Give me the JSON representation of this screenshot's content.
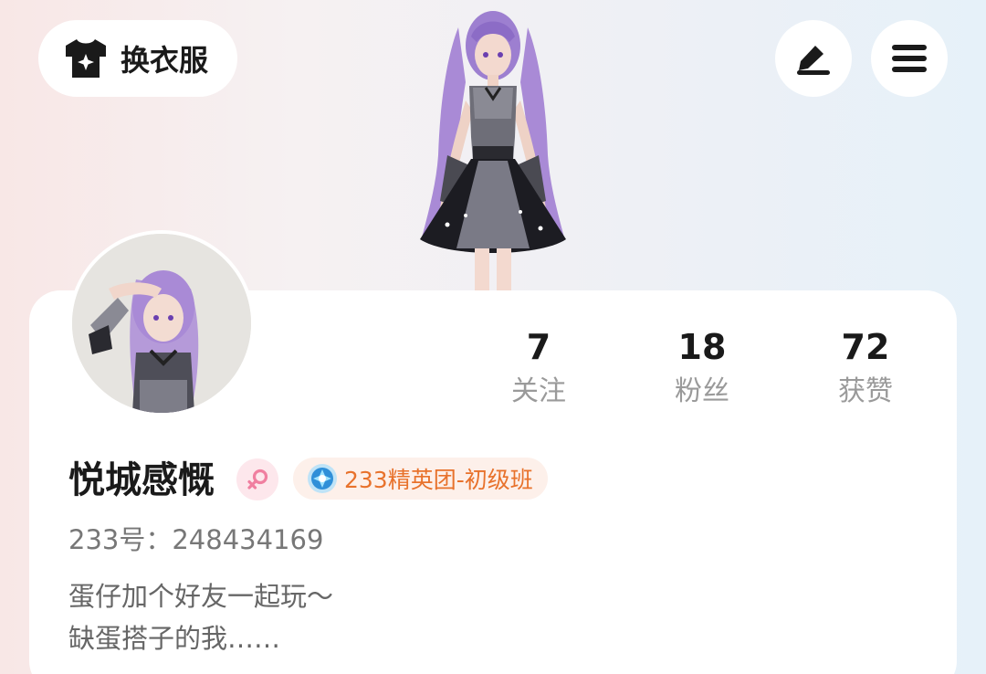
{
  "header": {
    "outfit_label": "换衣服",
    "outfit_icon": "tshirt-sparkle-icon",
    "edit_icon": "pen-icon",
    "menu_icon": "hamburger-menu-icon"
  },
  "profile": {
    "username": "悦城感慨",
    "gender_icon": "female-icon",
    "level_badge": "233精英团-初级班",
    "level_icon": "blue-gem-medal-icon",
    "user_id": "233号：248434169",
    "bio_lines": [
      "蛋仔加个好友一起玩～",
      "缺蛋搭子的我……"
    ]
  },
  "stats": [
    {
      "value": "7",
      "label": "关注"
    },
    {
      "value": "18",
      "label": "粉丝"
    },
    {
      "value": "72",
      "label": "获赞"
    }
  ],
  "colors": {
    "level_text": "#e8722c",
    "gender_pink": "#f07fa0",
    "stat_label": "#9a9a9a"
  }
}
